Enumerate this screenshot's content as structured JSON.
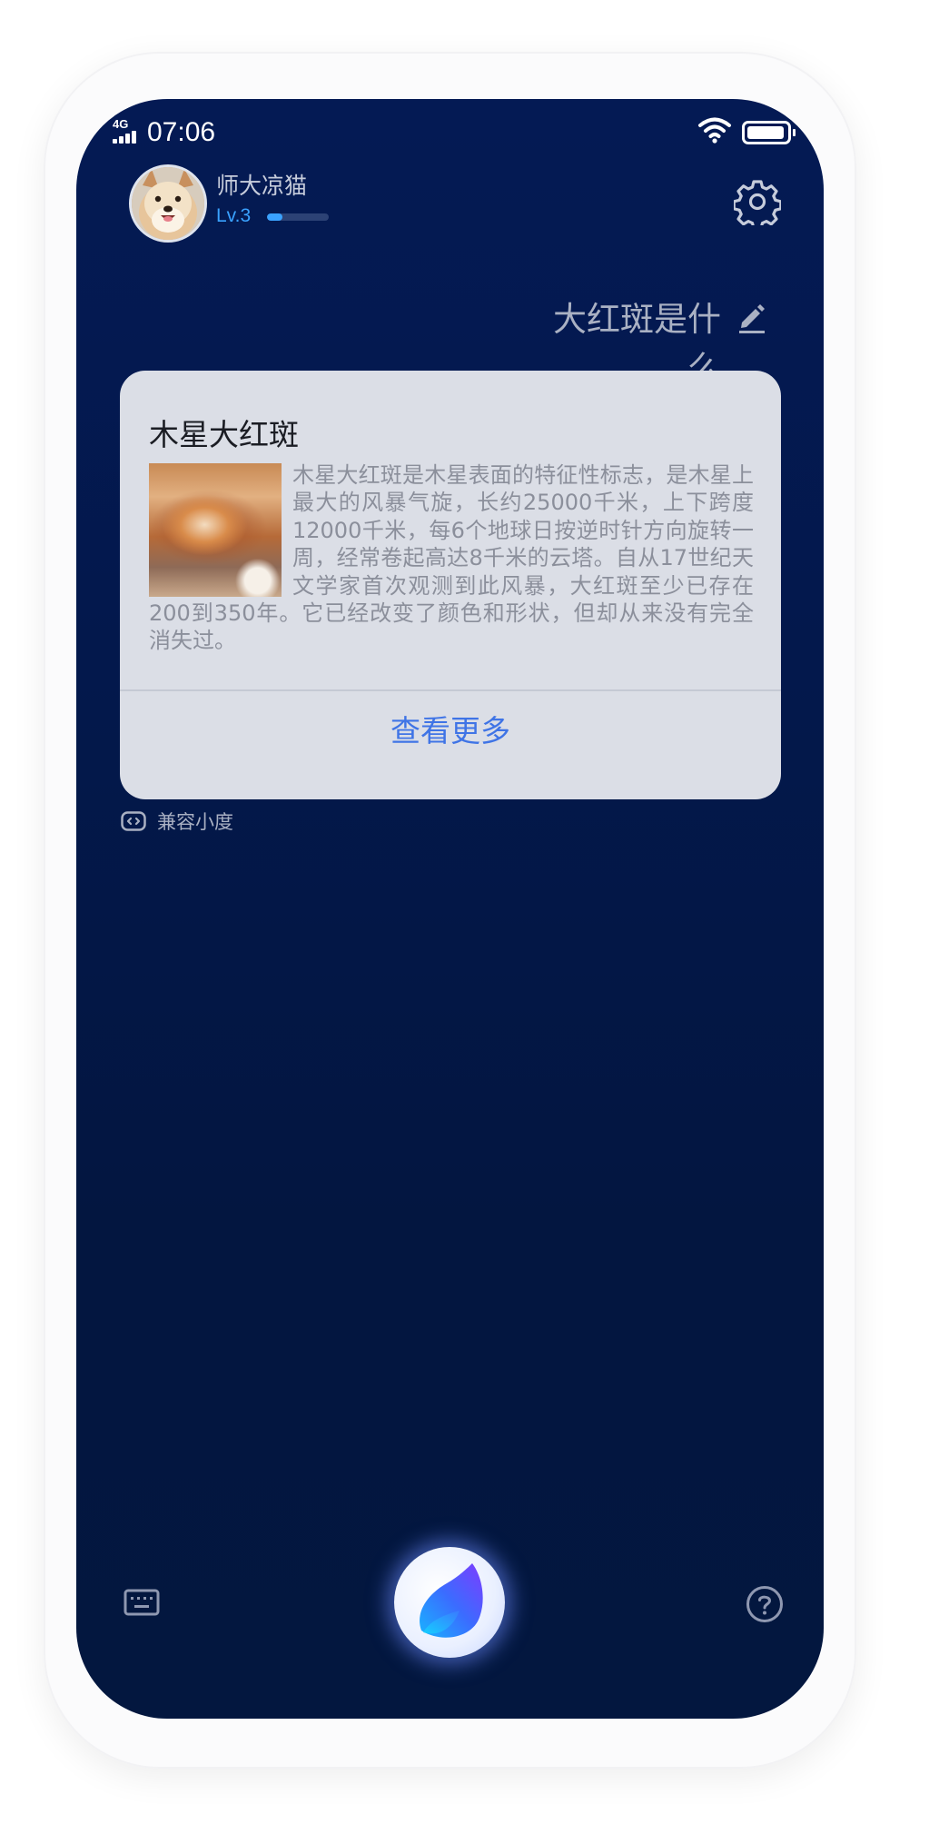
{
  "status_bar": {
    "network": "4G",
    "time": "07:06",
    "battery_level": 0.95
  },
  "user": {
    "name": "师大凉猫",
    "level": "Lv.3",
    "level_progress": 0.25
  },
  "query": {
    "text": "大红斑是什么"
  },
  "card": {
    "title": "木星大红斑",
    "body": "木星大红斑是木星表面的特征性标志，是木星上最大的风暴气旋，长约25000千米，上下跨度12000千米，每6个地球日按逆时针方向旋转一周，经常卷起高达8千米的云塔。自从17世纪天文学家首次观测到此风暴，大红斑至少已存在200到350年。它已经改变了颜色和形状，但却从来没有完全消失过。",
    "more_label": "查看更多"
  },
  "compat": {
    "label": "兼容小度"
  },
  "colors": {
    "screen_bg": "#041a54",
    "card_bg": "#dbdee6",
    "accent_blue": "#3f74e6",
    "level_blue": "#3aa2ff"
  },
  "icons": {
    "settings": "gear-icon",
    "edit": "pencil-icon",
    "keyboard": "keyboard-icon",
    "help": "help-icon",
    "compat": "device-icon",
    "mic": "voice-assistant-icon",
    "wifi": "wifi-icon",
    "battery": "battery-icon",
    "signal": "signal-icon"
  }
}
